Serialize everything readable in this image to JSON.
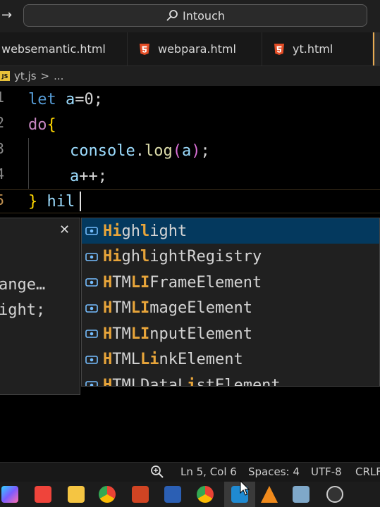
{
  "titlebar": {
    "search_text": "Intouch"
  },
  "tabs": [
    {
      "label": "websemantic.html"
    },
    {
      "label": "webpara.html"
    },
    {
      "label": "yt.html"
    },
    {
      "label": ""
    }
  ],
  "breadcrumb": {
    "badge": "JS",
    "file": "yt.js",
    "sep": ">",
    "rest": "..."
  },
  "editor": {
    "line_numbers": [
      "1",
      "2",
      "3",
      "4",
      "5"
    ],
    "lines": {
      "l1_kw": "let",
      "l1_rest_var": "a",
      "l1_rest": "=0;",
      "l2_kw": "do",
      "l2_brace": "{",
      "l3_obj": "console",
      "l3_dot": ".",
      "l3_fn": "log",
      "l3_paren_open": "(",
      "l3_arg": "a",
      "l3_paren_close": ")",
      "l3_semi": ";",
      "l4_var": "a",
      "l4_rest": "++;",
      "l5_brace": "}",
      "l5_typed": "hil"
    }
  },
  "details": {
    "close_glyph": "✕",
    "line1": "ange…",
    "line2": "ight;"
  },
  "suggestions": [
    {
      "parts": [
        [
          "Hi",
          true
        ],
        [
          "gh",
          false
        ],
        [
          "l",
          true
        ],
        [
          "ight",
          false
        ]
      ]
    },
    {
      "parts": [
        [
          "Hi",
          true
        ],
        [
          "gh",
          false
        ],
        [
          "l",
          true
        ],
        [
          "ightRegistry",
          false
        ]
      ]
    },
    {
      "parts": [
        [
          "H",
          true
        ],
        [
          "TM",
          false
        ],
        [
          "LI",
          true
        ],
        [
          "FrameElement",
          false
        ]
      ]
    },
    {
      "parts": [
        [
          "H",
          true
        ],
        [
          "TM",
          false
        ],
        [
          "LI",
          true
        ],
        [
          "mageElement",
          false
        ]
      ]
    },
    {
      "parts": [
        [
          "H",
          true
        ],
        [
          "TM",
          false
        ],
        [
          "LI",
          true
        ],
        [
          "nputElement",
          false
        ]
      ]
    },
    {
      "parts": [
        [
          "H",
          true
        ],
        [
          "TML",
          false
        ],
        [
          "Li",
          true
        ],
        [
          "nkElement",
          false
        ]
      ]
    },
    {
      "parts": [
        [
          "H",
          true
        ],
        [
          "TMLDataL",
          false
        ],
        [
          "i",
          true
        ],
        [
          "stElement",
          false
        ]
      ]
    }
  ],
  "statusbar": {
    "position": "Ln 5, Col 6",
    "spaces": "Spaces: 4",
    "encoding": "UTF-8",
    "eol": "CRLF"
  },
  "taskbar": {
    "icons": [
      "copilot-icon",
      "anydesk-icon",
      "file-explorer-icon",
      "chrome-icon",
      "powerpoint-icon",
      "word-icon",
      "chrome-profile-icon",
      "vscode-icon",
      "vlc-icon",
      "paint-icon",
      "obs-icon"
    ]
  }
}
